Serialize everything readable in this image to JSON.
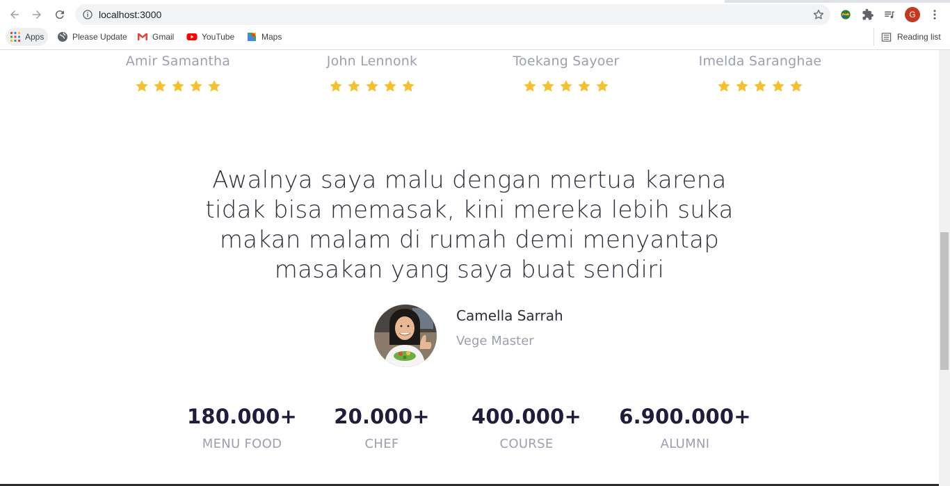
{
  "browser": {
    "url": "localhost:3000",
    "profile_initial": "G",
    "bookmarks": [
      {
        "label": "Apps",
        "icon": "apps-grid-icon"
      },
      {
        "label": "Please Update",
        "icon": "globe-icon"
      },
      {
        "label": "Gmail",
        "icon": "gmail-icon"
      },
      {
        "label": "YouTube",
        "icon": "youtube-icon"
      },
      {
        "label": "Maps",
        "icon": "maps-icon"
      }
    ],
    "reading_list_label": "Reading list"
  },
  "reviewers": [
    {
      "name": "Amir Samantha",
      "rating": 5
    },
    {
      "name": "John Lennonk",
      "rating": 5
    },
    {
      "name": "Toekang Sayoer",
      "rating": 5
    },
    {
      "name": "Imelda Saranghae",
      "rating": 5
    }
  ],
  "testimonial": {
    "quote": "Awalnya saya malu dengan mertua karena tidak bisa memasak, kini mereka lebih suka makan malam di rumah demi menyantap masakan yang saya buat sendiri",
    "author_name": "Camella Sarrah",
    "author_role": "Vege Master"
  },
  "stats": [
    {
      "value": "180.000+",
      "label": "MENU FOOD"
    },
    {
      "value": "20.000+",
      "label": "CHEF"
    },
    {
      "value": "400.000+",
      "label": "COURSE"
    },
    {
      "value": "6.900.000+",
      "label": "ALUMNI"
    }
  ],
  "colors": {
    "star": "#f5c02c",
    "heading_dark": "#1f1d3b",
    "muted_text": "#9c9fae",
    "body_text": "#2c2e3a"
  }
}
